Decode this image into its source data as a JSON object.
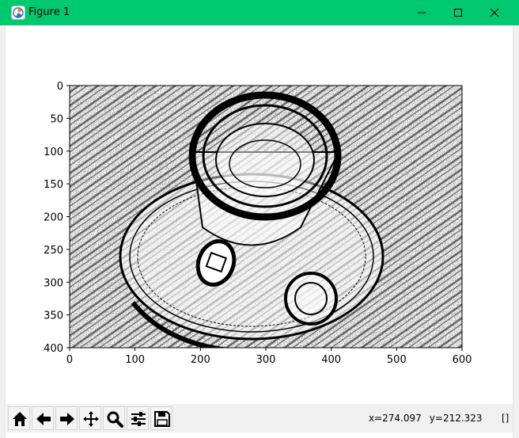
{
  "window": {
    "title": "Figure 1",
    "titlebar_color": "#00c86e"
  },
  "toolbar": {
    "buttons": [
      {
        "icon": "home-icon"
      },
      {
        "icon": "back-arrow-icon"
      },
      {
        "icon": "forward-arrow-icon"
      },
      {
        "icon": "pan-icon"
      },
      {
        "icon": "zoom-icon"
      },
      {
        "icon": "subplots-config-icon"
      },
      {
        "icon": "save-icon"
      }
    ],
    "x_readout": "x=274.097",
    "y_readout": "y=212.323",
    "status": "[]"
  },
  "chart_data": {
    "type": "image",
    "x_ticks": [
      "0",
      "100",
      "200",
      "300",
      "400",
      "500",
      "600"
    ],
    "y_ticks": [
      "0",
      "50",
      "100",
      "150",
      "200",
      "250",
      "300",
      "350",
      "400"
    ],
    "xlim": [
      0,
      600
    ],
    "ylim": [
      400,
      0
    ],
    "colormap": "binary"
  }
}
